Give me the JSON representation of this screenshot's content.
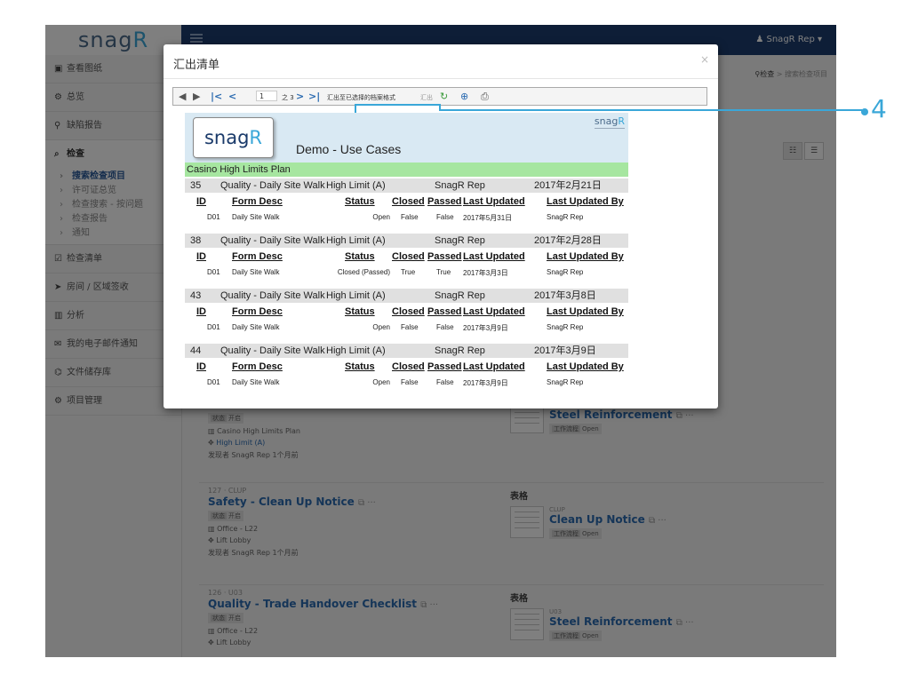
{
  "sidebar": {
    "logo_text": "snag",
    "logo_r": "R",
    "items": [
      {
        "icon": "▣",
        "label": "查看图纸"
      },
      {
        "icon": "⚙",
        "label": "总览"
      },
      {
        "icon": "⚲",
        "label": "缺陷报告"
      }
    ],
    "active": {
      "icon": "⌕",
      "label": "检查"
    },
    "sub_items": [
      "搜索检查项目",
      "许可证总览",
      "检查搜索 - 按问题",
      "检查报告",
      "通知"
    ],
    "more_items": [
      {
        "icon": "☑",
        "label": "检查清单"
      },
      {
        "icon": "➤",
        "label": "房间 / 区域签收"
      },
      {
        "icon": "▥",
        "label": "分析"
      },
      {
        "icon": "✉",
        "label": "我的电子邮件通知"
      },
      {
        "icon": "⌬",
        "label": "文件储存库"
      },
      {
        "icon": "⚙",
        "label": "项目管理"
      }
    ]
  },
  "topbar": {
    "user": "SnagR Rep ▾",
    "user_icon": "♟"
  },
  "breadcrumb": {
    "item1": "检查",
    "sep": ">",
    "item2": "搜索检查项目"
  },
  "cards": [
    {
      "status_label": "状态",
      "status_value": "开启",
      "plan": "Casino High Limits Plan",
      "location": "High Limit (A)",
      "found": "发现者 SnagR Rep 1个月前",
      "form_code": "",
      "form_name": "Steel Reinforcement",
      "wf_label": "工作流程",
      "wf_value": "Open"
    },
    {
      "id": "127 · CLUP",
      "title": "Safety - Clean Up Notice",
      "status_label": "状态",
      "status_value": "开启",
      "plan": "Office - L22",
      "location": "Lift Lobby",
      "found": "发现者 SnagR Rep 1个月前",
      "form_label": "表格",
      "form_code": "CLUP",
      "form_name": "Clean Up Notice",
      "wf_label": "工作流程",
      "wf_value": "Open"
    },
    {
      "id": "126 · U03",
      "title": "Quality - Trade Handover Checklist",
      "status_label": "状态",
      "status_value": "开启",
      "plan": "Office - L22",
      "location": "Lift Lobby",
      "form_label": "表格",
      "form_code": "U03",
      "form_name": "Steel Reinforcement",
      "wf_label": "工作流程",
      "wf_value": "Open"
    }
  ],
  "modal": {
    "title": "汇出清单",
    "close": "×",
    "toolbar": {
      "page_value": "1",
      "page_of": "之 3",
      "export_format_label": "汇出至已选择的档案格式",
      "export_label": "汇出"
    },
    "report": {
      "logo": "snag",
      "logo_r": "R",
      "small_logo": "snag",
      "small_logo_r": "R",
      "title": "Demo - Use Cases",
      "plan": "Casino High Limits Plan",
      "headers": {
        "id": "ID",
        "form_desc": "Form Desc",
        "status": "Status",
        "closed": "Closed",
        "passed": "Passed",
        "last_updated": "Last Updated",
        "last_updated_by": "Last Updated By"
      },
      "groups": [
        {
          "num": "35",
          "name": "Quality - Daily Site Walk",
          "location": "High Limit (A)",
          "user": "SnagR Rep",
          "date": "2017年2月21日",
          "row": {
            "id": "D01",
            "form": "Daily Site Walk",
            "status": "Open",
            "closed": "False",
            "passed": "False",
            "updated": "2017年5月31日",
            "by": "SnagR Rep"
          }
        },
        {
          "num": "38",
          "name": "Quality - Daily Site Walk",
          "location": "High Limit (A)",
          "user": "SnagR Rep",
          "date": "2017年2月28日",
          "row": {
            "id": "D01",
            "form": "Daily Site Walk",
            "status": "Closed (Passed)",
            "closed": "True",
            "passed": "True",
            "updated": "2017年3月3日",
            "by": "SnagR Rep"
          }
        },
        {
          "num": "43",
          "name": "Quality - Daily Site Walk",
          "location": "High Limit (A)",
          "user": "SnagR Rep",
          "date": "2017年3月8日",
          "row": {
            "id": "D01",
            "form": "Daily Site Walk",
            "status": "Open",
            "closed": "False",
            "passed": "False",
            "updated": "2017年3月9日",
            "by": "SnagR Rep"
          }
        },
        {
          "num": "44",
          "name": "Quality - Daily Site Walk",
          "location": "High Limit (A)",
          "user": "SnagR Rep",
          "date": "2017年3月9日",
          "row": {
            "id": "D01",
            "form": "Daily Site Walk",
            "status": "Open",
            "closed": "False",
            "passed": "False",
            "updated": "2017年3月9日",
            "by": "SnagR Rep"
          }
        }
      ]
    }
  },
  "callout": {
    "number": "4",
    "color": "#3aa7d8"
  }
}
